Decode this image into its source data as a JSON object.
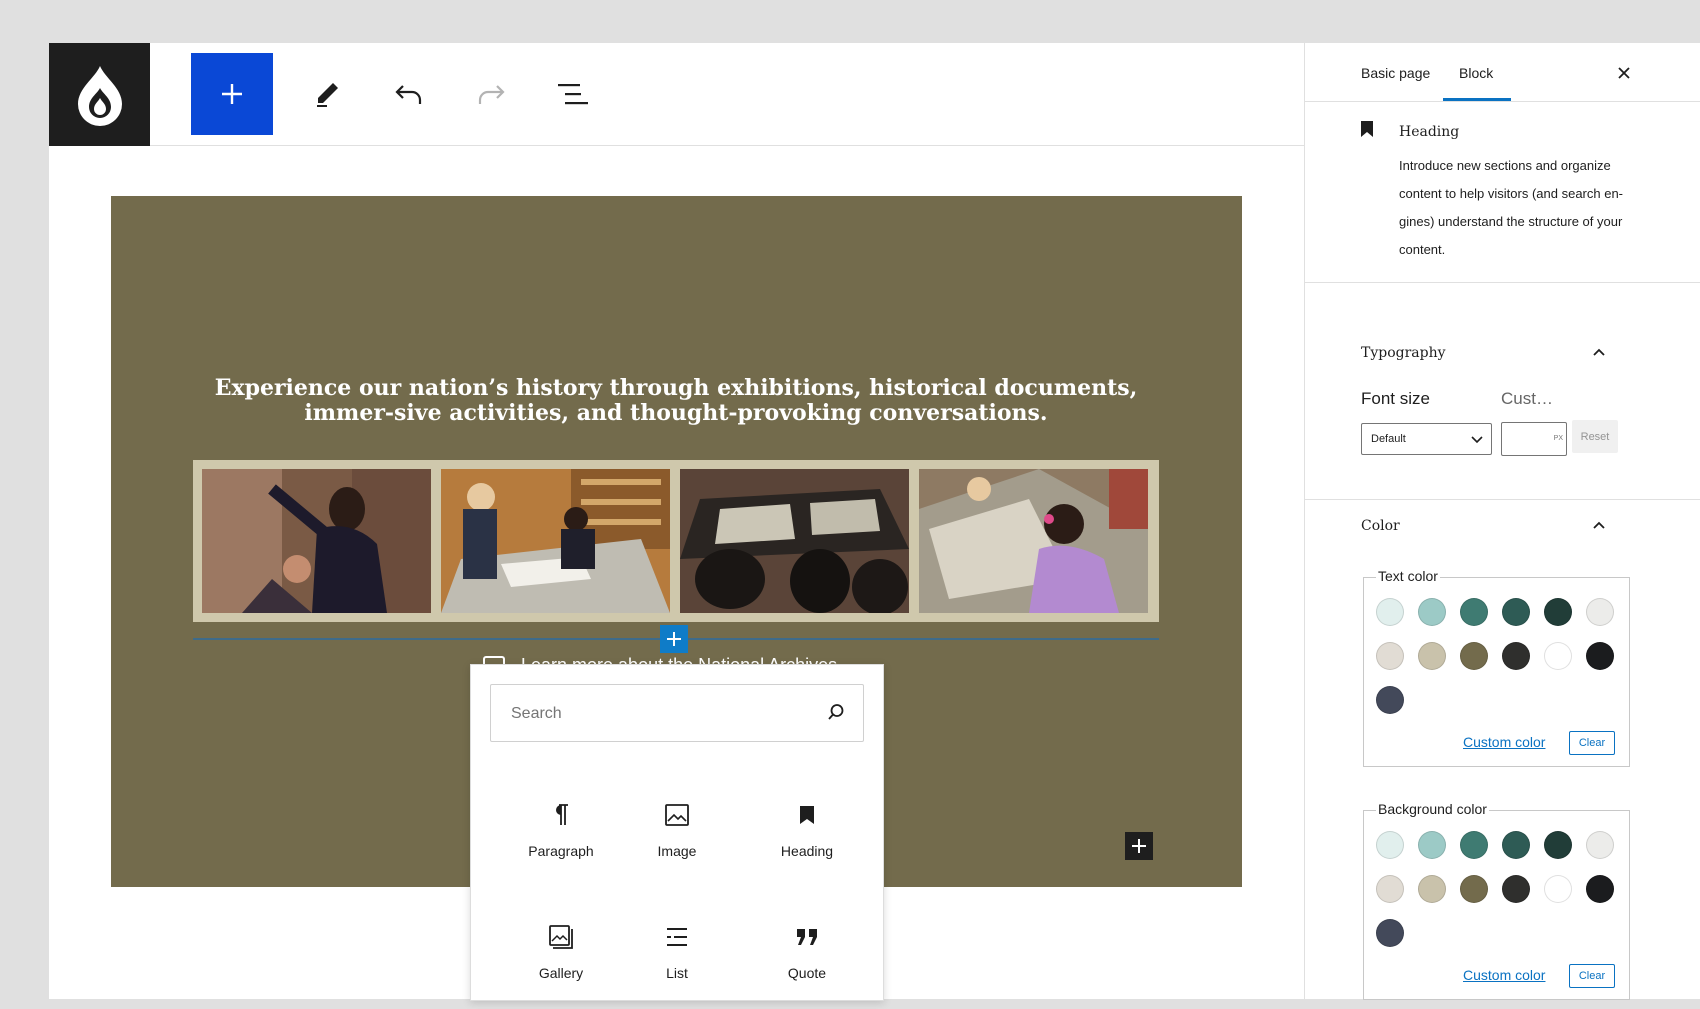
{
  "toolbar": {
    "logo_icon": "drupal-drop-icon",
    "inserter_icon": "plus-icon",
    "tools": [
      "pencil-icon",
      "undo-icon",
      "redo-icon",
      "list-view-icon"
    ]
  },
  "canvas": {
    "hero_bg": "#736b4c",
    "hero_text": "Experience our nation’s history through exhibitions, historical documents, immer-sive activities, and thought-provoking conversations.",
    "hidden_text": "Learn more about the National Archives",
    "photos": [
      "photo-1",
      "photo-2",
      "photo-3",
      "photo-4"
    ]
  },
  "inserter_popover": {
    "search_placeholder": "Search",
    "blocks": [
      {
        "label": "Paragraph",
        "icon": "paragraph-icon"
      },
      {
        "label": "Image",
        "icon": "image-icon"
      },
      {
        "label": "Heading",
        "icon": "bookmark-icon"
      },
      {
        "label": "Gallery",
        "icon": "gallery-icon"
      },
      {
        "label": "List",
        "icon": "list-icon"
      },
      {
        "label": "Quote",
        "icon": "quote-icon"
      }
    ]
  },
  "sidebar": {
    "tabs": [
      {
        "label": "Basic page"
      },
      {
        "label": "Block"
      }
    ],
    "active_tab": "Block",
    "block_card": {
      "title": "Heading",
      "description": "Introduce new sections and organize content to help visitors (and search en-gines) understand the structure of your content."
    },
    "typography": {
      "title": "Typography",
      "font_size_label": "Font size",
      "custom_label": "Cust…",
      "select_value": "Default",
      "px_unit": "PX",
      "reset_label": "Reset"
    },
    "color": {
      "title": "Color",
      "text_color": {
        "legend": "Text color",
        "custom_label": "Custom color",
        "clear_label": "Clear"
      },
      "background_color": {
        "legend": "Background color",
        "custom_label": "Custom color",
        "clear_label": "Clear"
      },
      "palette": [
        "#e1efed",
        "#9ccac6",
        "#3f7b72",
        "#2e5b55",
        "#213d38",
        "#ececea",
        "#e1dcd4",
        "#c9c2ab",
        "#736b4c",
        "#2f2f2d",
        "#ffffff",
        "#1b1c1e",
        "#43495a"
      ]
    }
  }
}
